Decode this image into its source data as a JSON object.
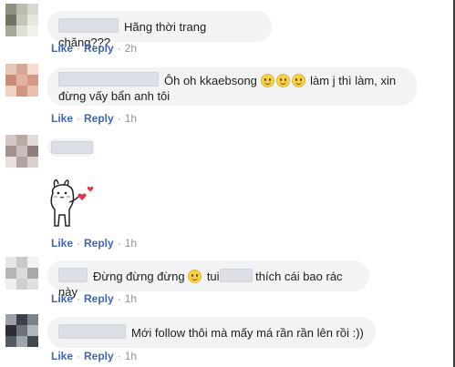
{
  "comments": [
    {
      "text": "Hãng thời trang chăng???",
      "actions": {
        "like": "Like",
        "reply": "Reply",
        "time": "2h"
      }
    },
    {
      "text_part1": "Ôh oh kkaebsong",
      "text_part2": "làm j thì làm, xin",
      "text_line2": "đừng vấy bẩn anh tôi",
      "actions": {
        "like": "Like",
        "reply": "Reply",
        "time": "1h"
      }
    },
    {
      "sticker_icon": "bunny-heart-sticker",
      "actions": {
        "like": "Like",
        "reply": "Reply",
        "time": "1h"
      }
    },
    {
      "text_part1": "Đừng đừng đừng",
      "text_part2": "tui",
      "text_part3": "thích cái bao rác này",
      "actions": {
        "like": "Like",
        "reply": "Reply",
        "time": "1h"
      }
    },
    {
      "text": "Mới follow thôi mà mấy má rần rần lên rồi :))",
      "actions": {
        "like": "Like",
        "reply": "Reply",
        "time": "1h"
      }
    }
  ],
  "colors": {
    "bubble": "#f2f3f5",
    "action_link": "#4267b2",
    "meta": "#90949c",
    "emoji": "#f7d247"
  }
}
